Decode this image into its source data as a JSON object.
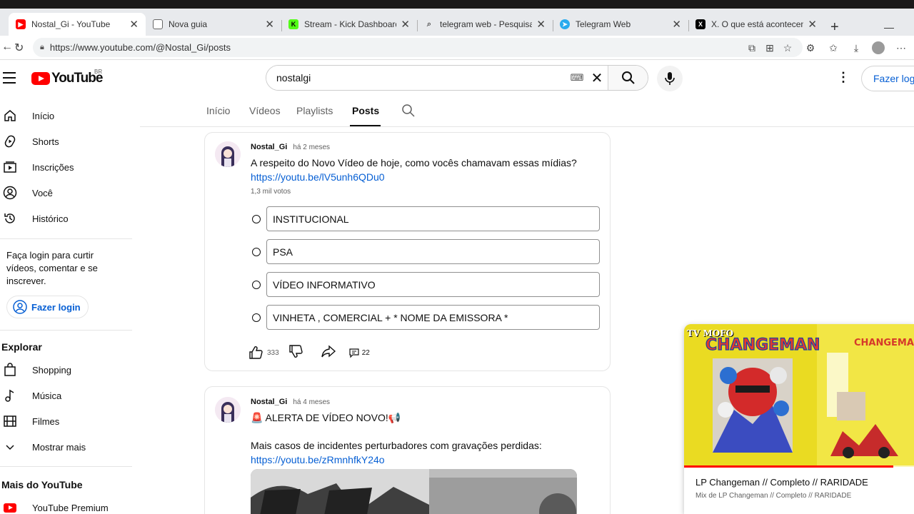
{
  "browser": {
    "tabs": [
      {
        "label": "Nostal_Gi - YouTube",
        "icon": "youtube-icon",
        "active": true
      },
      {
        "label": "Nova guia",
        "icon": "new-tab-page-icon",
        "active": false
      },
      {
        "label": "Stream - Kick Dashboard",
        "icon": "kick-icon",
        "active": false
      },
      {
        "label": "telegram web - Pesquisar",
        "icon": "search-icon",
        "active": false
      },
      {
        "label": "Telegram Web",
        "icon": "telegram-icon",
        "active": false
      },
      {
        "label": "X. O que está acontecendo / X",
        "icon": "x-logo-icon",
        "active": false
      }
    ],
    "tab_close": "✕",
    "new_tab": "+",
    "url": "https://www.youtube.com/@Nostal_Gi/posts"
  },
  "header": {
    "logo_text": "YouTube",
    "country": "BR",
    "search_value": "nostalgi",
    "login_label": "Fazer login"
  },
  "sidebar": {
    "main": [
      {
        "label": "Início",
        "icon": "home-icon"
      },
      {
        "label": "Shorts",
        "icon": "shorts-icon"
      },
      {
        "label": "Inscrições",
        "icon": "subscriptions-icon"
      },
      {
        "label": "Você",
        "icon": "you-icon"
      },
      {
        "label": "Histórico",
        "icon": "history-icon"
      }
    ],
    "login_prompt": "Faça login para curtir vídeos, comentar e se inscrever.",
    "login_label": "Fazer login",
    "explore_title": "Explorar",
    "explore": [
      {
        "label": "Shopping",
        "icon": "shopping-icon"
      },
      {
        "label": "Música",
        "icon": "music-icon"
      },
      {
        "label": "Filmes",
        "icon": "movies-icon"
      },
      {
        "label": "Mostrar mais",
        "icon": "chevron-down-icon"
      }
    ],
    "more_title": "Mais do YouTube",
    "more": [
      {
        "label": "YouTube Premium",
        "icon": "youtube-premium-icon"
      }
    ]
  },
  "channel_tabs": [
    "Início",
    "Vídeos",
    "Playlists",
    "Posts"
  ],
  "channel_active_tab": "Posts",
  "posts": [
    {
      "author": "Nostal_Gi",
      "time": "há 2 meses",
      "text": "A respeito do Novo Vídeo de hoje, como vocês chamavam essas mídias?",
      "link": "https://youtu.be/lV5unh6QDu0",
      "votes": "1,3 mil votos",
      "options": [
        "INSTITUCIONAL",
        "PSA",
        "VÍDEO INFORMATIVO",
        "VINHETA , COMERCIAL + * NOME DA EMISSORA *"
      ],
      "likes": "333",
      "comments": "22"
    },
    {
      "author": "Nostal_Gi",
      "time": "há 4 meses",
      "text": "🚨 ALERTA DE VÍDEO NOVO!📢",
      "text2": "Mais casos de incidentes perturbadores com gravações perdidas:",
      "link": "https://youtu.be/zRmnhfkY24o"
    }
  ],
  "miniplayer": {
    "title": "LP Changeman // Completo // RARIDADE",
    "subtitle": "Mix de LP Changeman // Completo // RARIDADE",
    "overlay_text": "TV MOFO",
    "progress": 0.91
  },
  "colors": {
    "brand_red": "#ff0000",
    "link_blue": "#065fd4",
    "kick_green": "#53fc18",
    "telegram_blue": "#2aabee"
  }
}
